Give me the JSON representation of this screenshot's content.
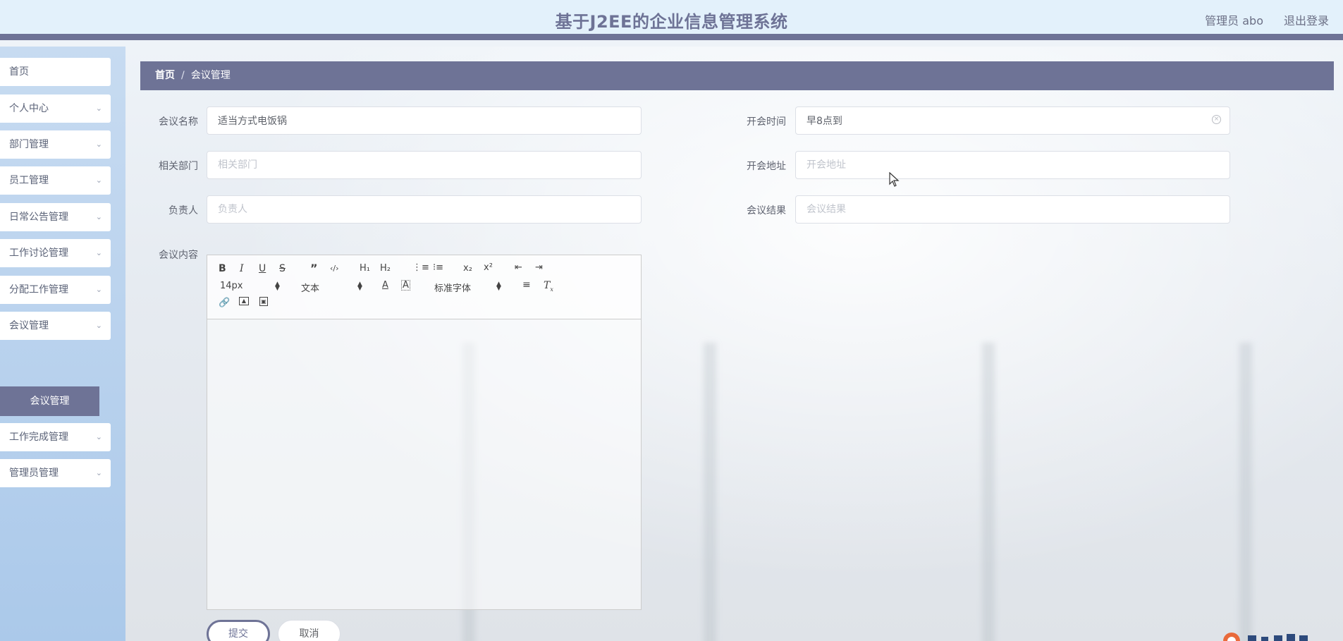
{
  "header": {
    "title": "基于J2EE的企业信息管理系统",
    "user": "管理员 abo",
    "logout": "退出登录"
  },
  "sidebar": {
    "items": [
      {
        "label": "首页",
        "has_children": false
      },
      {
        "label": "个人中心",
        "has_children": true
      },
      {
        "label": "部门管理",
        "has_children": true
      },
      {
        "label": "员工管理",
        "has_children": true
      },
      {
        "label": "日常公告管理",
        "has_children": true
      },
      {
        "label": "工作讨论管理",
        "has_children": true
      },
      {
        "label": "分配工作管理",
        "has_children": true
      },
      {
        "label": "会议管理",
        "has_children": true
      },
      {
        "label": "工作完成管理",
        "has_children": true
      },
      {
        "label": "管理员管理",
        "has_children": true
      }
    ],
    "active_sub": "会议管理"
  },
  "breadcrumb": {
    "home": "首页",
    "separator": "/",
    "current": "会议管理"
  },
  "form": {
    "meeting_name": {
      "label": "会议名称",
      "value": "适当方式电饭锅",
      "placeholder": "会议名称"
    },
    "start_time": {
      "label": "开会时间",
      "value": "早8点到",
      "placeholder": "开会时间"
    },
    "department": {
      "label": "相关部门",
      "value": "",
      "placeholder": "相关部门"
    },
    "address": {
      "label": "开会地址",
      "value": "",
      "placeholder": "开会地址"
    },
    "owner": {
      "label": "负责人",
      "value": "",
      "placeholder": "负责人"
    },
    "result": {
      "label": "会议结果",
      "value": "",
      "placeholder": "会议结果"
    },
    "content": {
      "label": "会议内容"
    }
  },
  "editor": {
    "font_size": "14px",
    "text_type": "文本",
    "font_family": "标准字体",
    "tools": [
      "bold-icon",
      "italic-icon",
      "underline-icon",
      "strike-icon",
      "blockquote-icon",
      "code-block-icon",
      "h1-icon",
      "h2-icon",
      "ordered-list-icon",
      "bullet-list-icon",
      "subscript-icon",
      "superscript-icon",
      "outdent-icon",
      "indent-icon",
      "text-color-icon",
      "background-color-icon",
      "align-icon",
      "clear-format-icon",
      "link-icon",
      "image-icon",
      "video-icon"
    ]
  },
  "buttons": {
    "submit": "提交",
    "cancel": "取消"
  },
  "colors": {
    "accent": "#6e7396",
    "header_bg": "#e3f1fb",
    "sidebar_bg": "#abc9ea"
  }
}
